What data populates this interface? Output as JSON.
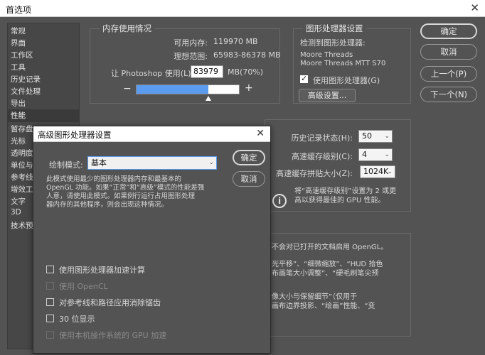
{
  "window": {
    "title": "首选项",
    "close": "✕"
  },
  "sidebar": {
    "items": [
      "常规",
      "界面",
      "工作区",
      "工具",
      "历史记录",
      "文件处理",
      "导出",
      "性能",
      "暂存盘",
      "光标",
      "透明度",
      "单位与",
      "参考线",
      "增效工",
      "文字",
      "3D",
      "技术预"
    ],
    "selected_index": 7
  },
  "memory": {
    "title": "内存使用情况",
    "available_label": "可用内存:",
    "available_value": "119970 MB",
    "range_label": "理想范围:",
    "range_value": "65983-86378 MB",
    "let_label": "让 Photoshop 使用(L):",
    "let_value": "83979",
    "let_unit": "MB(70%)",
    "minus": "−",
    "plus": "+",
    "usage_fraction": 0.7
  },
  "gpu": {
    "title": "图形处理器设置",
    "detected_label": "检测到图形处理器:",
    "vendor": "Moore Threads",
    "model": "Moore Threads MTT S70",
    "use_label": "使用图形处理器(G)",
    "use_checked": true,
    "advanced_button": "高级设置..."
  },
  "history": {
    "states_label": "历史记录状态(H):",
    "states_value": "50",
    "cache_levels_label": "高速缓存级别(C):",
    "cache_levels_value": "4",
    "tile_label": "高速缓存拼贴大小(Z):",
    "tile_value": "1024K",
    "info_line1": "将“高速缓存级别”设置为 2 或更",
    "info_line2": "高以获得最佳的 GPU 性能。"
  },
  "background_partial": {
    "line1": "不会对已打开的文档启用 OpenGL。",
    "line2": "光平移”、“细微缩放”、“HUD 拾色",
    "line3": "布画笔大小调整”、“硬毛刷笔尖预",
    "line4": "像大小与保留细节”（仅用于",
    "line5": "画布边界投影、“绘画”性能、“变"
  },
  "buttons": {
    "ok": "确定",
    "cancel": "取消",
    "prev": "上一个(P)",
    "next": "下一个(N)"
  },
  "modal": {
    "title": "高级图形处理器设置",
    "close": "✕",
    "draw_mode_label": "绘制模式:",
    "draw_mode_value": "基本",
    "desc_line1": "此模式使用最少的图形处理器内存和最基本的",
    "desc_line2": "OpenGL 功能。如果“正常”和“高级”模式的性能差强",
    "desc_line3": "人意，请使用此模式。如果例行运行占用图形处理",
    "desc_line4": "器内存的其他程序，则会出现这种情况。",
    "ok": "确定",
    "cancel": "取消",
    "options": [
      {
        "label": "使用图形处理器加速计算",
        "checked": false,
        "disabled": false
      },
      {
        "label": "使用 OpenCL",
        "checked": false,
        "disabled": true
      },
      {
        "label": "对参考线和路径应用消除锯齿",
        "checked": false,
        "disabled": false
      },
      {
        "label": "30 位显示",
        "checked": false,
        "disabled": false
      },
      {
        "label": "使用本机操作系统的 GPU 加速",
        "checked": false,
        "disabled": true
      }
    ]
  },
  "colors": {
    "panel": "#535353",
    "slider_fill": "#5b9bf0",
    "slider_track": "#ffffff"
  }
}
